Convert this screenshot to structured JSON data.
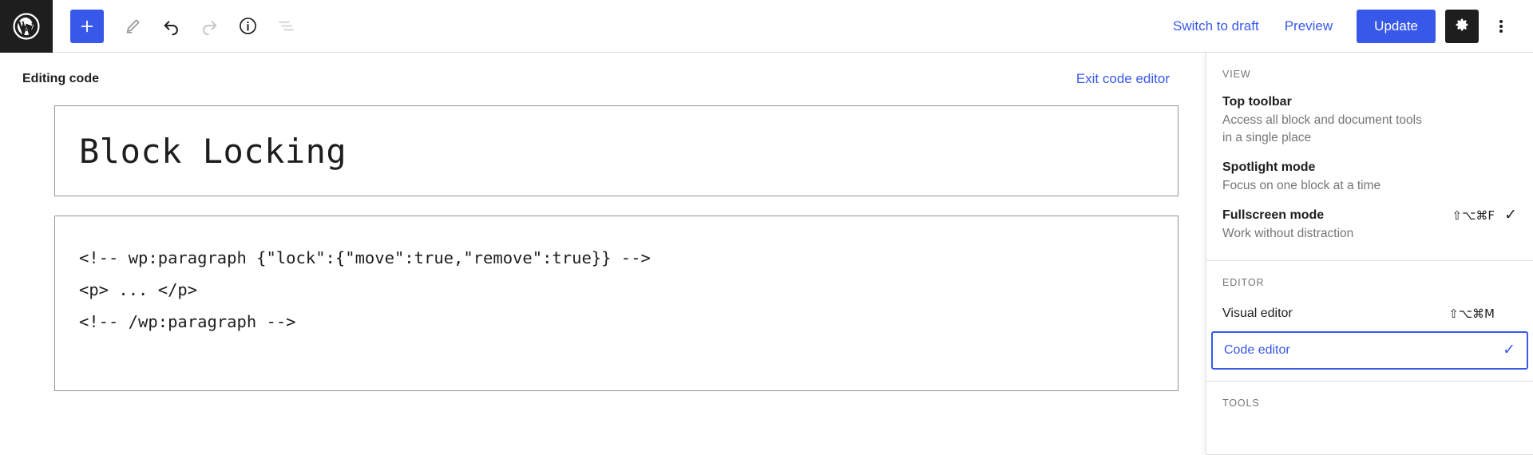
{
  "header": {
    "logo_icon": "wordpress-logo-icon",
    "tools": [
      {
        "name": "add-block-button",
        "icon": "plus-icon"
      },
      {
        "name": "edit-tool-button",
        "icon": "pencil-icon"
      },
      {
        "name": "undo-button",
        "icon": "undo-arrow-icon"
      },
      {
        "name": "redo-button",
        "icon": "redo-arrow-icon"
      },
      {
        "name": "details-button",
        "icon": "info-circle-icon"
      },
      {
        "name": "list-view-button",
        "icon": "list-view-icon"
      }
    ],
    "switch_to_draft_label": "Switch to draft",
    "preview_label": "Preview",
    "update_label": "Update",
    "settings_icon": "gear-icon",
    "more_options_icon": "three-dots-vertical-icon",
    "accent_color": "#3858e9",
    "dark_color": "#1e1e1e"
  },
  "editor": {
    "status_label": "Editing code",
    "exit_code_editor_label": "Exit code editor",
    "title_value": "Block Locking",
    "code_lines": [
      "<!-- wp:paragraph {\"lock\":{\"move\":true,\"remove\":true}} -->",
      "<p> ... </p>",
      "<!-- /wp:paragraph -->"
    ]
  },
  "menu": {
    "sections": [
      {
        "label": "VIEW",
        "items": [
          {
            "title": "Top toolbar",
            "description": "Access all block and document tools in a single place",
            "shortcut": "",
            "checked": false
          },
          {
            "title": "Spotlight mode",
            "description": "Focus on one block at a time",
            "shortcut": "",
            "checked": false
          },
          {
            "title": "Fullscreen mode",
            "description": "Work without distraction",
            "shortcut": "⇧⌥⌘F",
            "checked": true,
            "check_glyph": "✓"
          }
        ]
      },
      {
        "label": "EDITOR",
        "items": [
          {
            "title": "Visual editor",
            "description": "",
            "shortcut": "⇧⌥⌘M",
            "checked": false
          },
          {
            "title": "Code editor",
            "description": "",
            "shortcut": "",
            "checked": true,
            "check_glyph": "✓",
            "selected": true
          }
        ]
      },
      {
        "label": "TOOLS",
        "items": []
      }
    ]
  }
}
